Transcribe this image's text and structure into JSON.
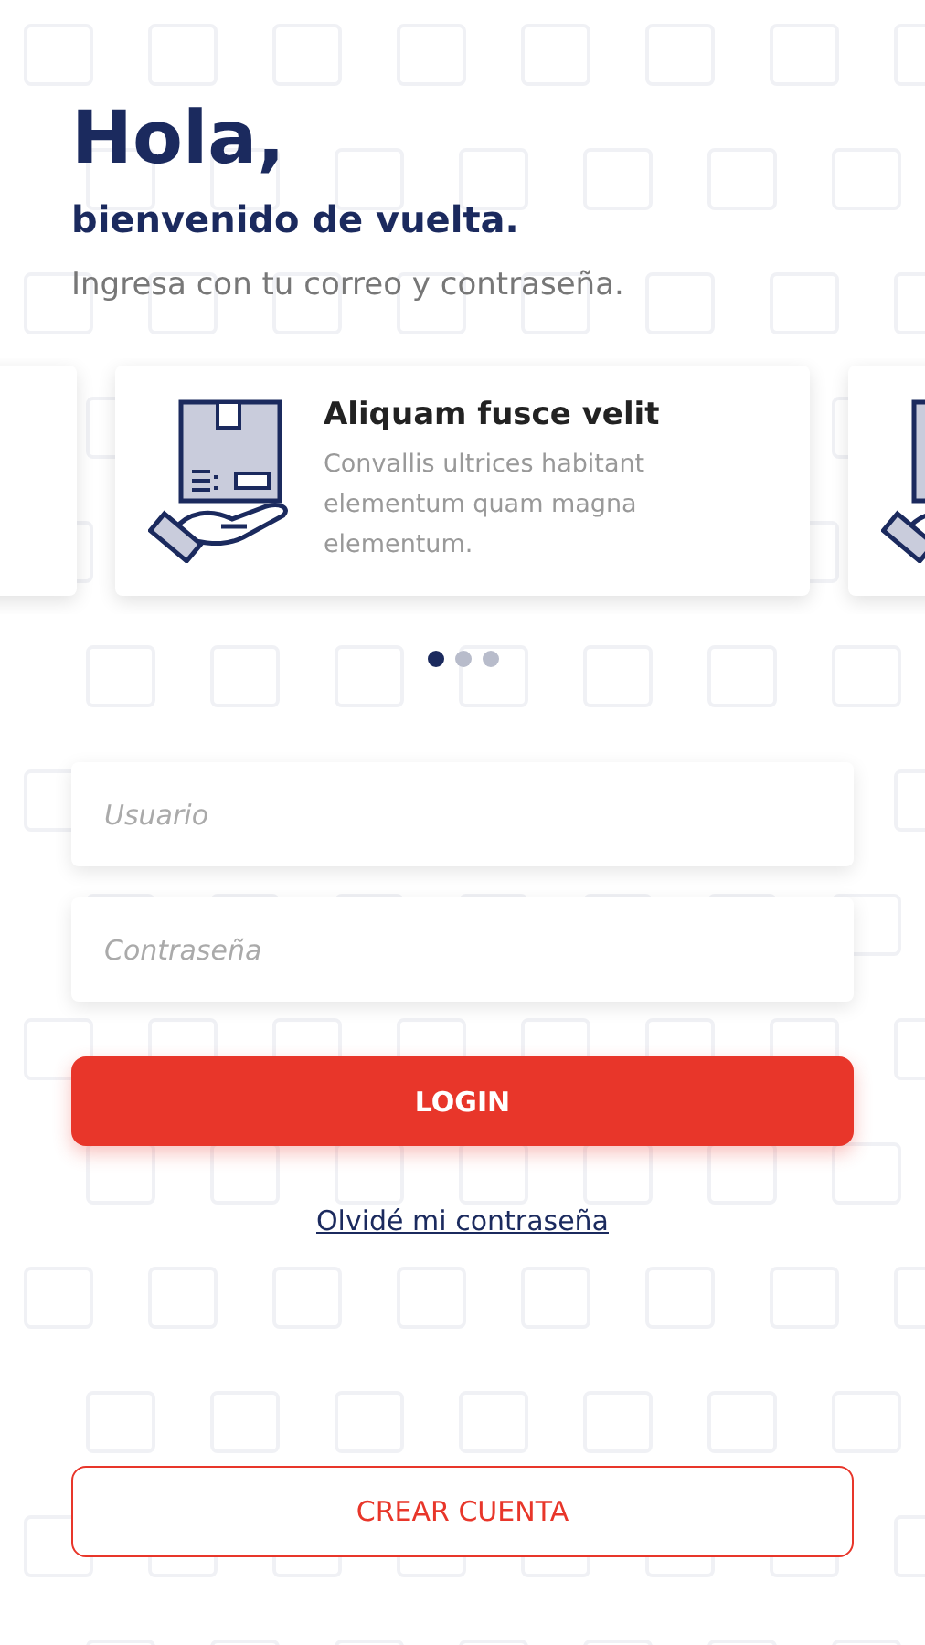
{
  "greeting": {
    "title": "Hola,",
    "subtitle": "bienvenido de vuelta.",
    "hint": "Ingresa con tu correo y contraseña."
  },
  "carousel": {
    "card": {
      "title": "Aliquam fusce velit",
      "text": "Convallis ultrices habitant elementum quam magna elementum."
    },
    "dots": [
      {
        "selected": true
      },
      {
        "selected": false
      },
      {
        "selected": false
      }
    ]
  },
  "fields": [
    {
      "placeholder": "Usuario"
    },
    {
      "placeholder": "Contraseña"
    }
  ],
  "login_button": "LOGIN",
  "forgot_link": "Olvidé mi contraseña",
  "create_account_button": "CREAR CUENTA"
}
